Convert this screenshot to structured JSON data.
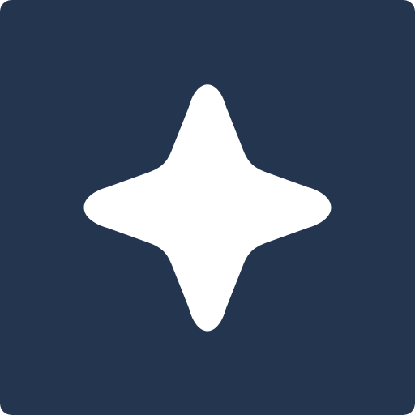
{
  "app_icon": {
    "symbol": "four-point-sparkle-icon",
    "background_color": "#24364f",
    "symbol_color": "#ffffff"
  }
}
